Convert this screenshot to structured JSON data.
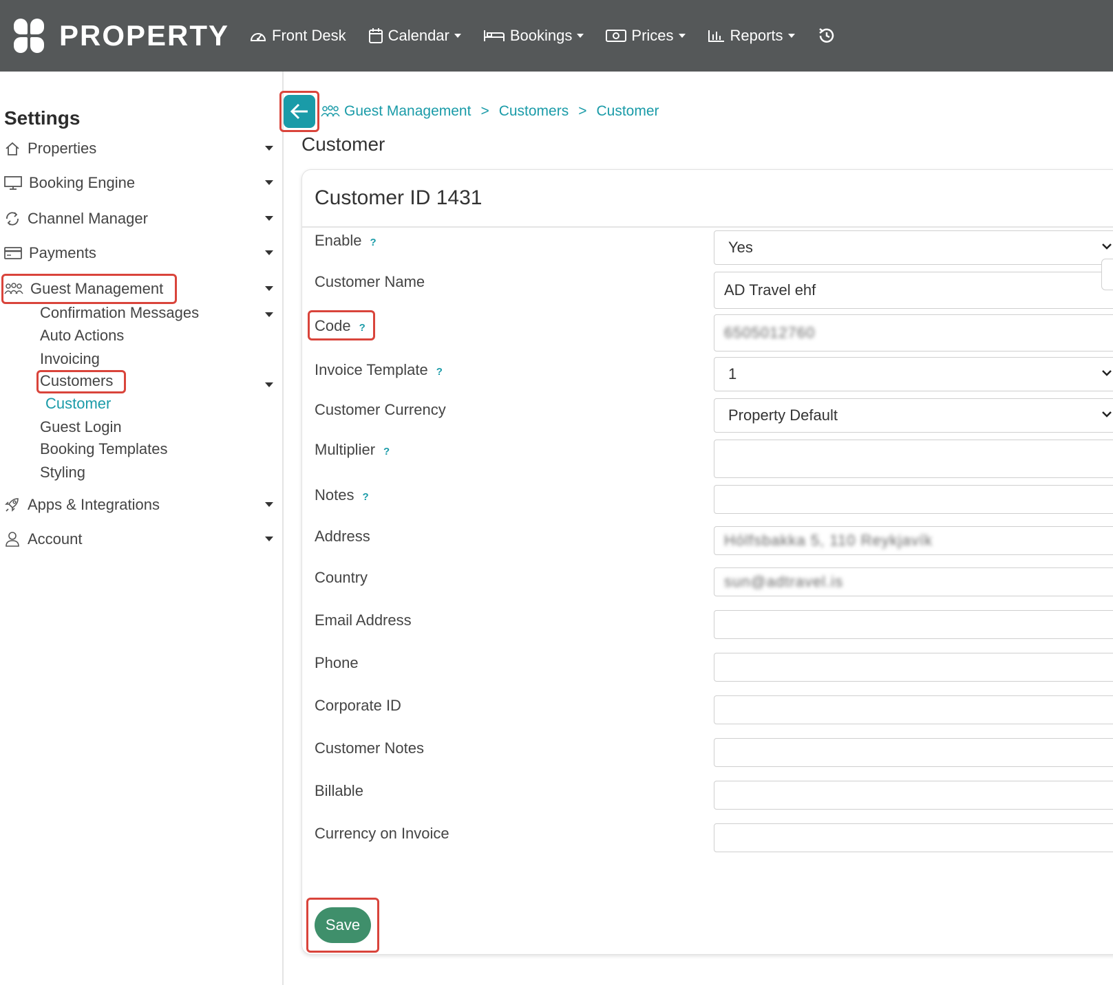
{
  "app": {
    "brand": "PROPERTY"
  },
  "nav": {
    "items": [
      {
        "label": "Front Desk",
        "icon": "speedometer-icon",
        "dropdown": false
      },
      {
        "label": "Calendar",
        "icon": "calendar-icon",
        "dropdown": true
      },
      {
        "label": "Bookings",
        "icon": "bed-icon",
        "dropdown": true
      },
      {
        "label": "Prices",
        "icon": "money-icon",
        "dropdown": true
      },
      {
        "label": "Reports",
        "icon": "bar-chart-icon",
        "dropdown": true
      }
    ],
    "history_icon": "history-icon"
  },
  "sidebar": {
    "title": "Settings",
    "items": [
      {
        "label": "Properties",
        "icon": "house-icon"
      },
      {
        "label": "Booking Engine",
        "icon": "monitor-icon"
      },
      {
        "label": "Channel Manager",
        "icon": "sync-icon"
      },
      {
        "label": "Payments",
        "icon": "credit-card-icon"
      },
      {
        "label": "Guest Management",
        "icon": "people-icon"
      }
    ],
    "sub_items": [
      {
        "label": "Confirmation Messages"
      },
      {
        "label": "Auto Actions"
      },
      {
        "label": "Invoicing"
      },
      {
        "label": "Customers"
      },
      {
        "label": "Customer"
      },
      {
        "label": "Guest Login"
      },
      {
        "label": "Booking Templates"
      },
      {
        "label": "Styling"
      }
    ],
    "bottom_items": [
      {
        "label": "Apps & Integrations",
        "icon": "rocket-icon"
      },
      {
        "label": "Account",
        "icon": "user-icon"
      }
    ]
  },
  "breadcrumb": [
    "Guest Management",
    "Customers",
    "Customer"
  ],
  "breadcrumb_sep": ">",
  "page_title": "Customer",
  "card": {
    "title": "Customer ID 1431",
    "help_mark": "?",
    "fields": {
      "enable": {
        "label": "Enable",
        "value": "Yes"
      },
      "customer_name": {
        "label": "Customer Name",
        "value": "AD Travel ehf"
      },
      "code": {
        "label": "Code",
        "value": "6505012760"
      },
      "invoice_template": {
        "label": "Invoice Template",
        "value": "1"
      },
      "customer_currency": {
        "label": "Customer Currency",
        "value": "Property Default"
      },
      "multiplier": {
        "label": "Multiplier",
        "value": ""
      },
      "notes": {
        "label": "Notes",
        "value": ""
      },
      "address": {
        "label": "Address",
        "value": "Hólfsbakka 5, 110 Reykjavík"
      },
      "country": {
        "label": "Country",
        "value": "sun@adtravel.is"
      },
      "email": {
        "label": "Email Address",
        "value": ""
      },
      "phone": {
        "label": "Phone",
        "value": ""
      },
      "corporate_id": {
        "label": "Corporate ID",
        "value": ""
      },
      "customer_notes": {
        "label": "Customer Notes",
        "value": ""
      },
      "billable": {
        "label": "Billable",
        "value": ""
      },
      "currency_on_invoice": {
        "label": "Currency on Invoice",
        "value": ""
      }
    },
    "save_label": "Save"
  },
  "colors": {
    "topbar": "#555859",
    "accent": "#1a9ba8",
    "save": "#3f8f6b",
    "highlight": "#d9443b"
  }
}
